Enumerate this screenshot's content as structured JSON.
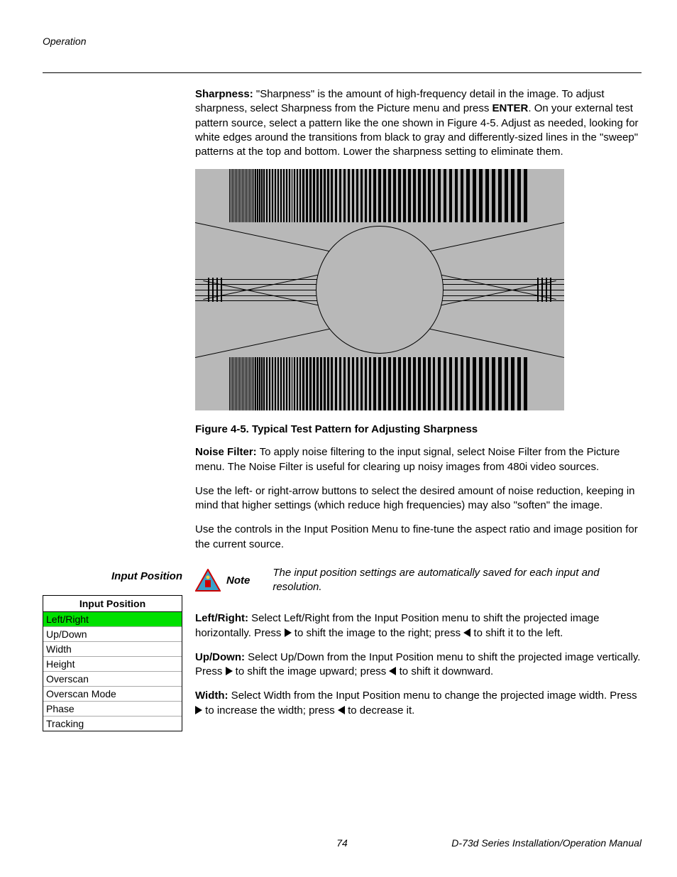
{
  "header": {
    "section": "Operation"
  },
  "sharpness": {
    "label": "Sharpness:",
    "text_a": " \"Sharpness\" is the amount of high-frequency detail in the image. To adjust sharpness, select Sharpness from the Picture menu and press ",
    "enter": "ENTER",
    "text_b": ". On your external test pattern source, select a pattern like the one shown in Figure 4-5. Adjust as needed, looking for white edges around the transitions from black to gray and differently-sized lines in the \"sweep\" patterns at the top and bottom. Lower the sharpness setting to eliminate them."
  },
  "figure_caption": "Figure 4-5. Typical Test Pattern for Adjusting Sharpness",
  "noise_filter": {
    "label": "Noise Filter:",
    "text": " To apply noise filtering to the input signal, select Noise Filter from the Picture menu. The Noise Filter is useful for clearing up noisy images from 480i video sources."
  },
  "noise_para2": "Use the left- or right-arrow buttons to select the desired amount of noise reduction, keeping in mind that higher settings (which reduce high frequencies) may also \"soften\" the image.",
  "input_position": {
    "sidebar_heading": "Input Position",
    "intro": "Use the controls in the Input Position Menu to fine-tune the aspect ratio and image position for the current source.",
    "note_label": "Note",
    "note_text": "The input position settings are automatically saved for each input and resolution.",
    "menu_title": "Input Position",
    "menu_items": [
      "Left/Right",
      "Up/Down",
      "Width",
      "Height",
      "Overscan",
      "Overscan Mode",
      "Phase",
      "Tracking"
    ]
  },
  "leftright": {
    "label": "Left/Right:",
    "a": " Select Left/Right from the Input Position menu to shift the projected image horizontally. Press ",
    "b": " to shift the image to the right; press ",
    "c": " to shift it to the left."
  },
  "updown": {
    "label": "Up/Down:",
    "a": " Select Up/Down from the Input Position menu to shift the projected image vertically. Press ",
    "b": " to shift the image upward; press ",
    "c": " to shift it downward."
  },
  "width": {
    "label": "Width:",
    "a": " Select Width from the Input Position menu to change the projected image width. Press ",
    "b": " to increase the width; press ",
    "c": " to decrease it."
  },
  "footer": {
    "page": "74",
    "manual": "D-73d Series Installation/Operation Manual"
  }
}
